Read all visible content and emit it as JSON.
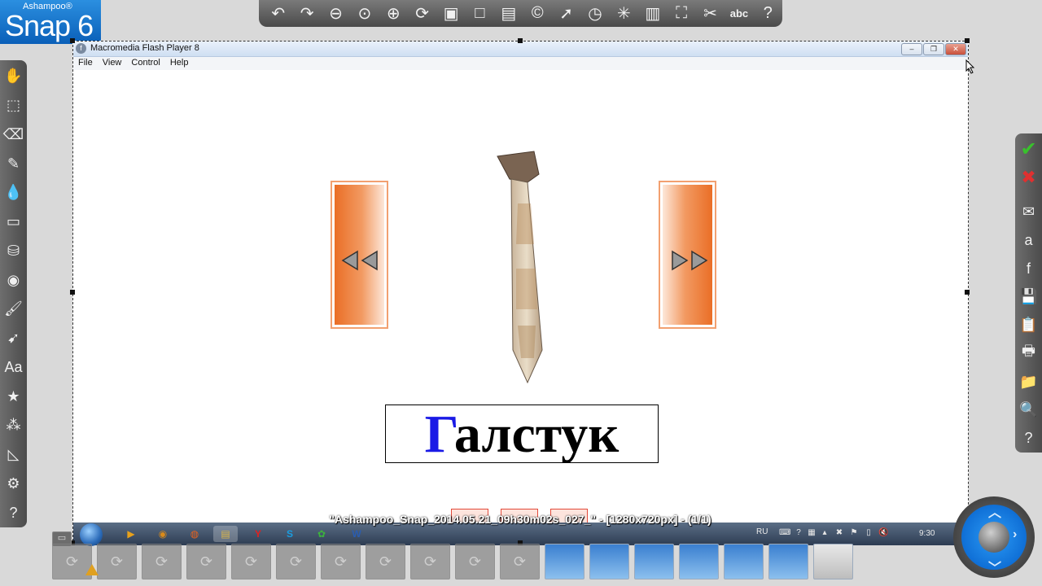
{
  "app": {
    "brand": "Ashampoo®",
    "product": "Snap 6"
  },
  "top_toolbar": {
    "buttons": [
      {
        "name": "undo-icon",
        "glyph": "↶"
      },
      {
        "name": "redo-icon",
        "glyph": "↷"
      },
      {
        "name": "zoom-out-icon",
        "glyph": "⊖"
      },
      {
        "name": "zoom-actual-icon",
        "glyph": "⊙"
      },
      {
        "name": "zoom-in-icon",
        "glyph": "⊕"
      },
      {
        "name": "rotate-icon",
        "glyph": "⟳"
      },
      {
        "name": "image-icon",
        "glyph": "▣"
      },
      {
        "name": "canvas-icon",
        "glyph": "□"
      },
      {
        "name": "fill-icon",
        "glyph": "▤"
      },
      {
        "name": "copyright-icon",
        "glyph": "©"
      },
      {
        "name": "pointer-icon",
        "glyph": "➚"
      },
      {
        "name": "timer-icon",
        "glyph": "◷"
      },
      {
        "name": "effects-icon",
        "glyph": "✳"
      },
      {
        "name": "filter-icon",
        "glyph": "▥"
      },
      {
        "name": "crop-icon",
        "glyph": "⛶"
      },
      {
        "name": "cut-icon",
        "glyph": "✂"
      },
      {
        "name": "ocr-icon",
        "glyph": "abc"
      },
      {
        "name": "help-icon",
        "glyph": "?"
      }
    ]
  },
  "left_toolbar": {
    "buttons": [
      {
        "name": "hand-icon",
        "glyph": "✋"
      },
      {
        "name": "select-icon",
        "glyph": "⬚"
      },
      {
        "name": "eraser-icon",
        "glyph": "⌫"
      },
      {
        "name": "pencil-icon",
        "glyph": "✎"
      },
      {
        "name": "drop-icon",
        "glyph": "💧"
      },
      {
        "name": "shapes-icon",
        "glyph": "▭"
      },
      {
        "name": "paint-bucket-icon",
        "glyph": "⛁"
      },
      {
        "name": "speech-bubble-icon",
        "glyph": "◉"
      },
      {
        "name": "brush-icon",
        "glyph": "🖌"
      },
      {
        "name": "arrow-icon",
        "glyph": "➹"
      },
      {
        "name": "text-icon",
        "glyph": "Aa"
      },
      {
        "name": "stamp-icon",
        "glyph": "★"
      },
      {
        "name": "numbering-icon",
        "glyph": "⁂"
      },
      {
        "name": "ruler-icon",
        "glyph": "◺"
      },
      {
        "name": "settings-icon",
        "glyph": "⚙"
      },
      {
        "name": "help-icon",
        "glyph": "?"
      }
    ]
  },
  "right_toolbar": {
    "buttons": [
      {
        "name": "apply-icon",
        "glyph": "✔",
        "kind": "ok"
      },
      {
        "name": "cancel-icon",
        "glyph": "✖",
        "kind": "cancel"
      },
      {
        "name": "email-icon",
        "glyph": "✉",
        "kind": ""
      },
      {
        "name": "web-upload-icon",
        "glyph": "a",
        "kind": ""
      },
      {
        "name": "facebook-icon",
        "glyph": "f",
        "kind": ""
      },
      {
        "name": "save-icon",
        "glyph": "💾",
        "kind": ""
      },
      {
        "name": "clipboard-icon",
        "glyph": "📋",
        "kind": ""
      },
      {
        "name": "print-icon",
        "glyph": "🖶",
        "kind": ""
      },
      {
        "name": "folder-icon",
        "glyph": "📁",
        "kind": ""
      },
      {
        "name": "preview-icon",
        "glyph": "🔍",
        "kind": ""
      },
      {
        "name": "help-icon",
        "glyph": "?",
        "kind": ""
      }
    ]
  },
  "window": {
    "title": "Macromedia Flash Player 8",
    "menu": [
      "File",
      "View",
      "Control",
      "Help"
    ],
    "controls": [
      "–",
      "❐",
      "✕"
    ]
  },
  "flash": {
    "word_first": "Г",
    "word_rest": "алстук",
    "prev_arrows": "◁◁",
    "next_arrows": "▷▷"
  },
  "taskbar": {
    "lang": "RU",
    "clock": "9:30",
    "apps": [
      {
        "name": "media-player-icon",
        "glyph": "▶",
        "color": "#e7a11b"
      },
      {
        "name": "app-icon",
        "glyph": "◉",
        "color": "#d98a1a"
      },
      {
        "name": "firefox-icon",
        "glyph": "◍",
        "color": "#e8621d"
      },
      {
        "name": "explorer-icon",
        "glyph": "▤",
        "color": "#d9b44a"
      },
      {
        "name": "yandex-icon",
        "glyph": "Y",
        "color": "#e02020"
      },
      {
        "name": "skype-icon",
        "glyph": "S",
        "color": "#1a9de0"
      },
      {
        "name": "icq-icon",
        "glyph": "✿",
        "color": "#3cb43c"
      },
      {
        "name": "word-icon",
        "glyph": "W",
        "color": "#2a5db0"
      }
    ]
  },
  "file_caption": "\"Ashampoo_Snap_2014.05.21_09h30m02s_027_\" - [1280x720px] - (1/1)",
  "thumbnails": {
    "count": 18,
    "shots_from": 11
  },
  "colors": {
    "accent_orange": "#ea6e26",
    "snap_blue": "#0f6fd6",
    "word_first_letter": "#1a1ae6"
  }
}
